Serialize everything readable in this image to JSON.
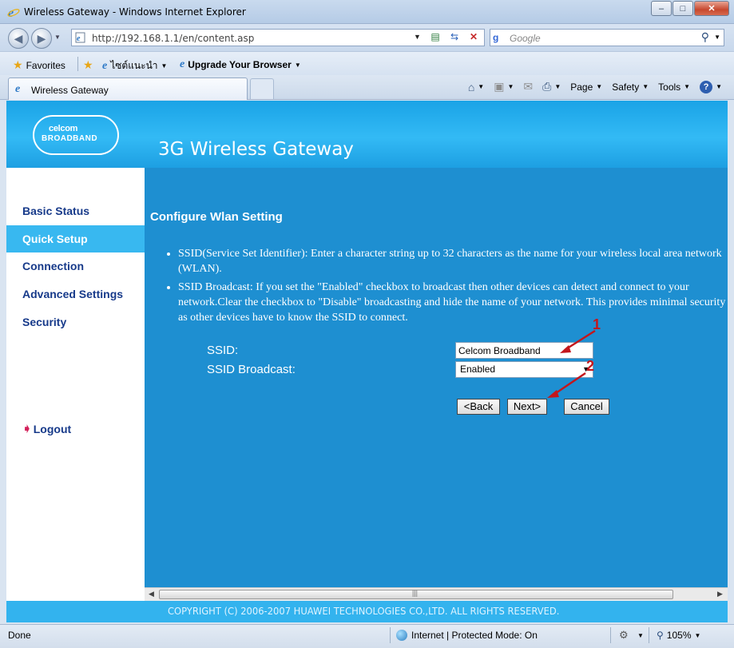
{
  "window": {
    "title": "Wireless Gateway - Windows Internet Explorer"
  },
  "addressbar": {
    "url": "http://192.168.1.1/en/content.asp",
    "search_placeholder": "Google"
  },
  "favorites": {
    "favorites_label": "Favorites",
    "suggested_label": "ไซต์แนะนำ",
    "upgrade_label": "Upgrade Your Browser"
  },
  "tab": {
    "title": "Wireless Gateway"
  },
  "commandbar": {
    "page_label": "Page",
    "safety_label": "Safety",
    "tools_label": "Tools"
  },
  "header": {
    "logo_line1": "celcom",
    "logo_line2": "BROADBAND",
    "title": "3G Wireless Gateway"
  },
  "sidebar": {
    "items": [
      {
        "label": "Basic Status"
      },
      {
        "label": "Quick Setup"
      },
      {
        "label": "Connection"
      },
      {
        "label": "Advanced Settings"
      },
      {
        "label": "Security"
      }
    ],
    "active_index": 1,
    "logout_label": "Logout"
  },
  "main": {
    "heading": "Configure Wlan Setting",
    "bullets": [
      "SSID(Service Set Identifier): Enter a character string up to 32 characters as the name for your wireless local area network (WLAN).",
      "SSID Broadcast: If you set the \"Enabled\" checkbox to broadcast then other devices can detect and connect to your network.Clear the checkbox to \"Disable\" broadcasting and hide the name of your network. This provides minimal security as other devices have to know the SSID to connect."
    ],
    "ssid_label": "SSID:",
    "ssid_value": "Celcom Broadband",
    "broadcast_label": "SSID Broadcast:",
    "broadcast_value": "Enabled",
    "back_label": "<Back",
    "next_label": "Next>",
    "cancel_label": "Cancel",
    "annotation_1": "1",
    "annotation_2": "2"
  },
  "footer": {
    "copyright": "COPYRIGHT (C) 2006-2007 HUAWEI TECHNOLOGIES CO.,LTD. ALL RIGHTS RESERVED."
  },
  "statusbar": {
    "status": "Done",
    "zone": "Internet | Protected Mode: On",
    "zoom": "105%"
  },
  "colors": {
    "header_blue": "#33baf5",
    "content_blue": "#1e8fd1",
    "menu_text": "#173a8a",
    "annotation_red": "#c4161c"
  }
}
